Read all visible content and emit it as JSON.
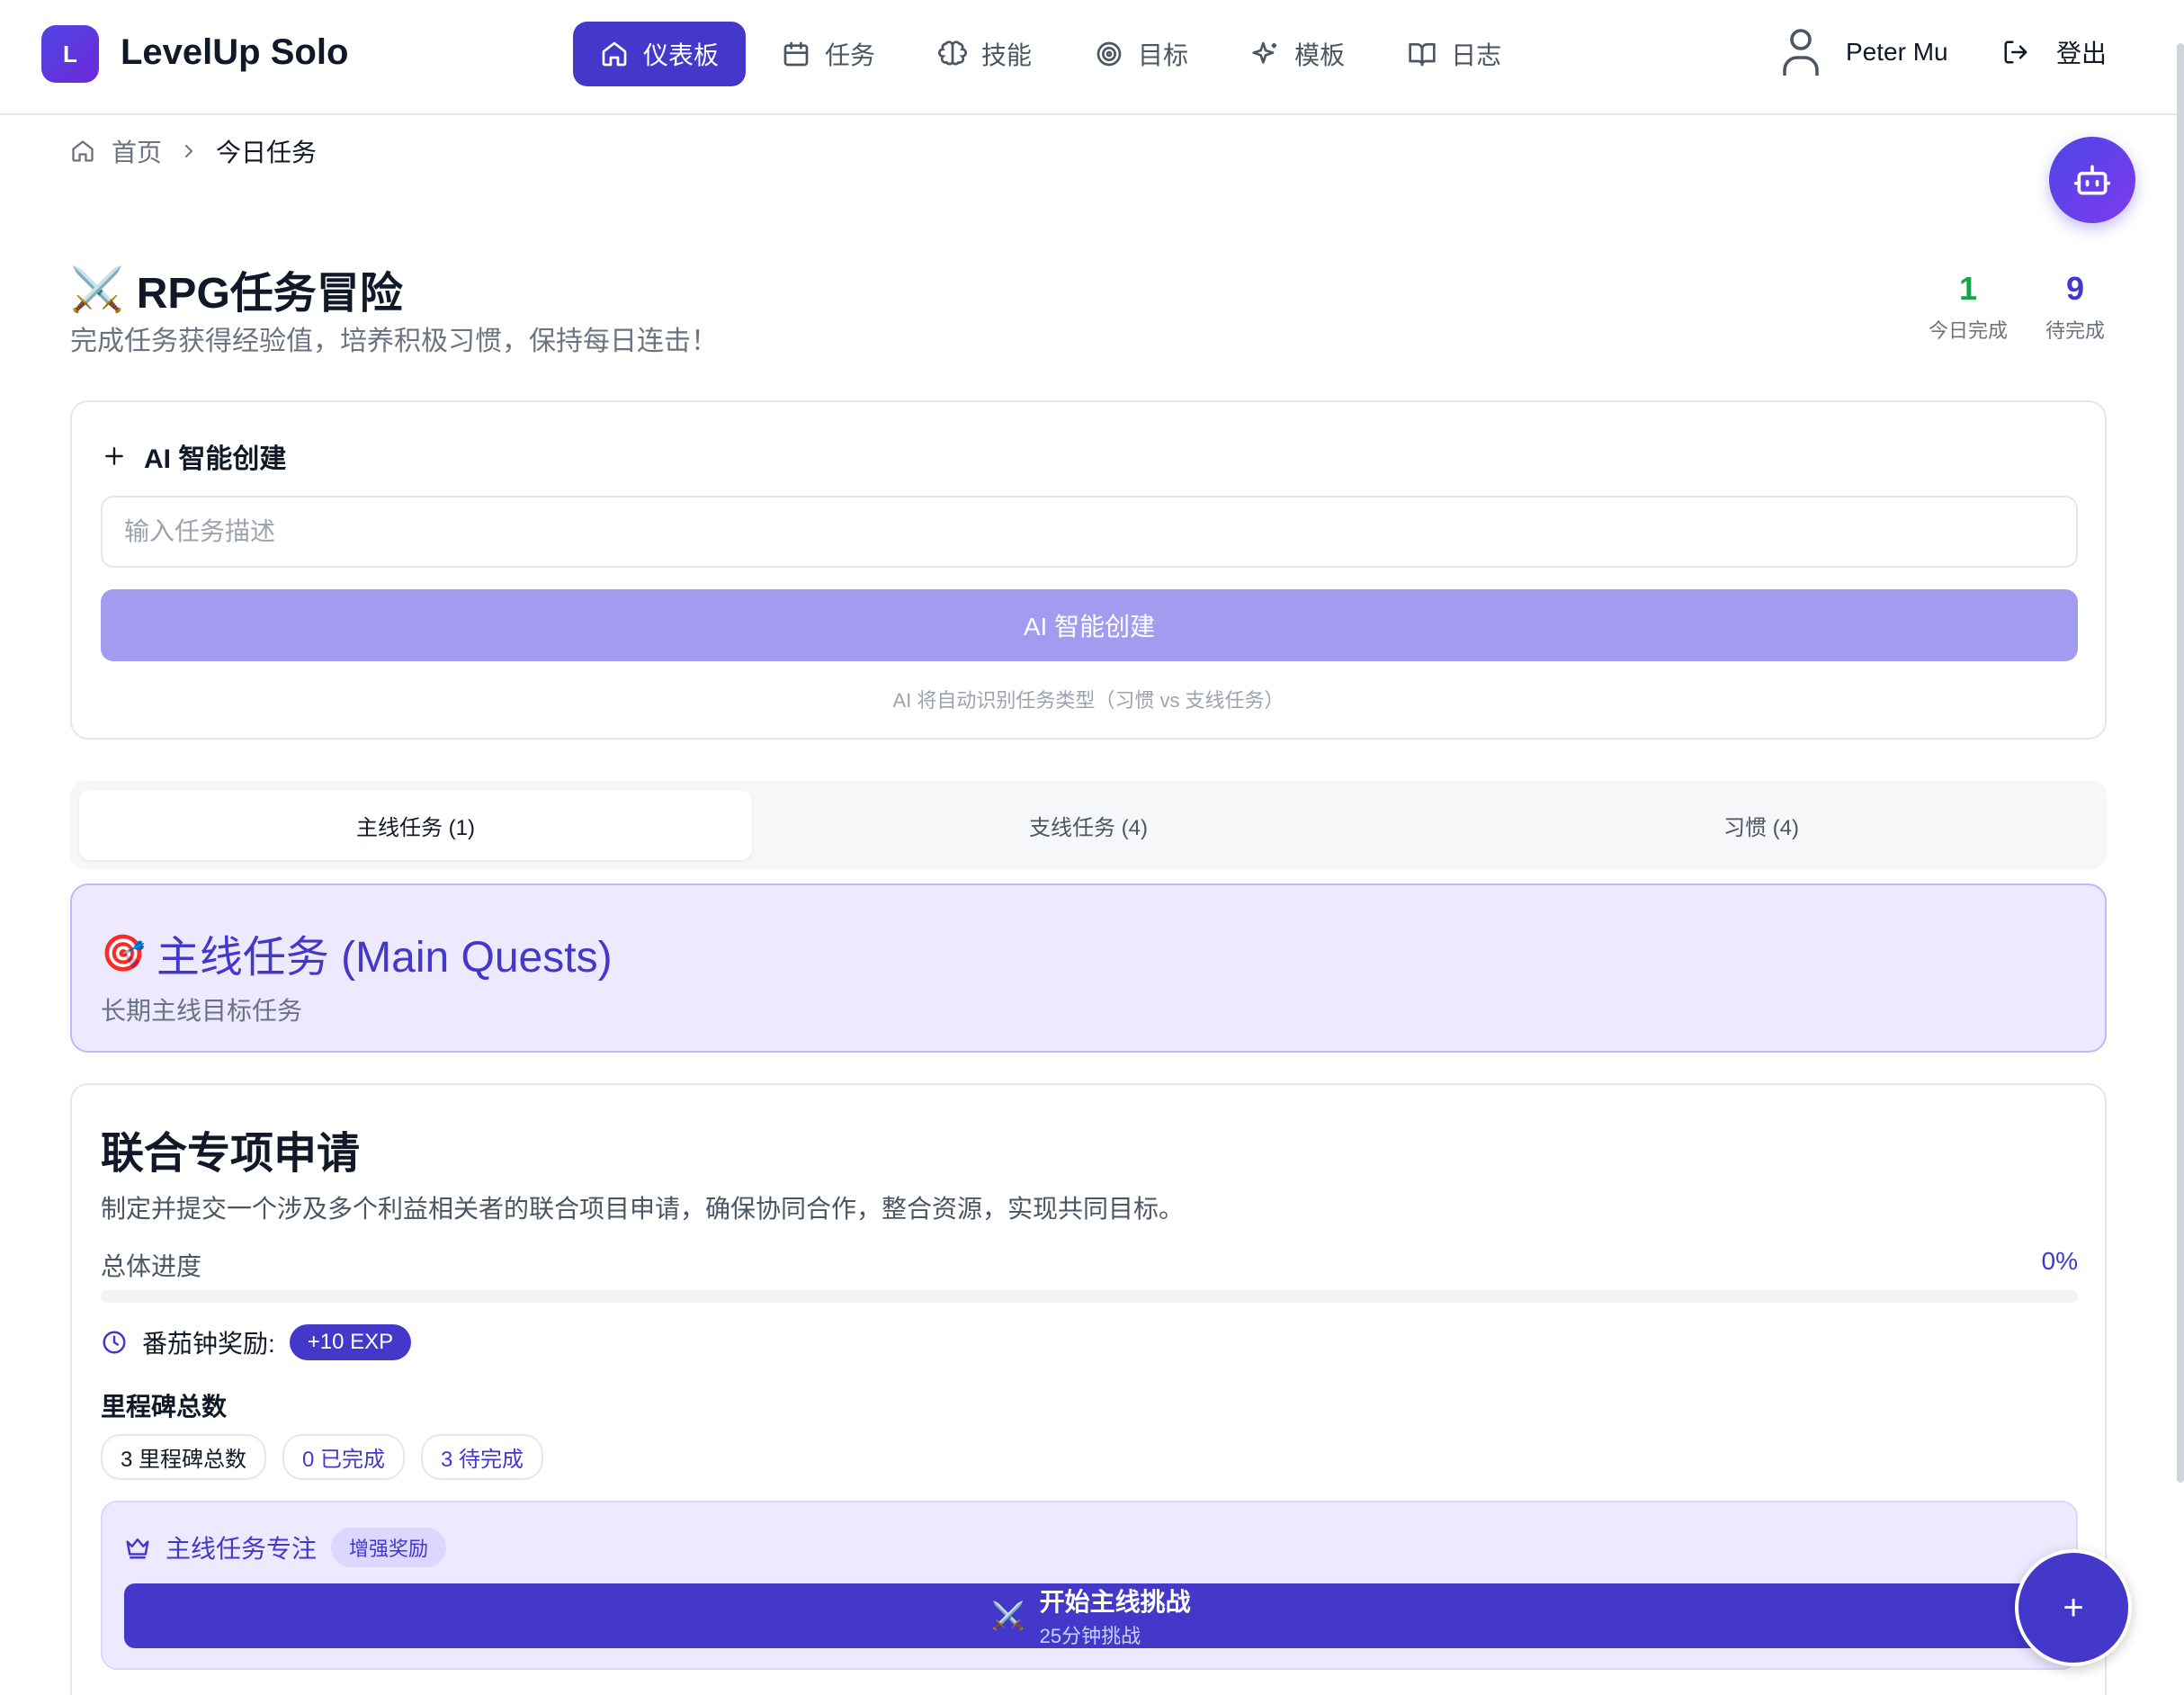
{
  "app": {
    "logo_letter": "L",
    "name": "LevelUp Solo"
  },
  "nav": {
    "items": [
      {
        "label": "仪表板",
        "icon": "home-icon",
        "active": true
      },
      {
        "label": "任务",
        "icon": "calendar-icon"
      },
      {
        "label": "技能",
        "icon": "brain-icon"
      },
      {
        "label": "目标",
        "icon": "target-icon"
      },
      {
        "label": "模板",
        "icon": "sparkles-icon"
      },
      {
        "label": "日志",
        "icon": "book-icon"
      }
    ],
    "user_name": "Peter Mu",
    "logout_label": "登出"
  },
  "breadcrumb": {
    "home": "首页",
    "current": "今日任务"
  },
  "header": {
    "title_emoji": "⚔️",
    "title": "RPG任务冒险",
    "subtitle": "完成任务获得经验值，培养积极习惯，保持每日连击！",
    "stats": [
      {
        "value": "1",
        "label": "今日完成",
        "color": "#16a34a"
      },
      {
        "value": "9",
        "label": "待完成",
        "color": "#4338ca"
      }
    ]
  },
  "ai_create": {
    "title": "AI 智能创建",
    "placeholder": "输入任务描述",
    "button": "AI 智能创建",
    "hint": "AI 将自动识别任务类型（习惯 vs 支线任务）"
  },
  "tabs": [
    {
      "label": "主线任务 (1)",
      "active": true
    },
    {
      "label": "支线任务 (4)"
    },
    {
      "label": "习惯 (4)"
    }
  ],
  "main_banner": {
    "emoji": "🎯",
    "title": "主线任务 (Main Quests)",
    "subtitle": "长期主线目标任务"
  },
  "quest": {
    "title": "联合专项申请",
    "description": "制定并提交一个涉及多个利益相关者的联合项目申请，确保协同合作，整合资源，实现共同目标。",
    "progress_label": "总体进度",
    "progress_value": "0%",
    "progress_fraction": 0,
    "pomodoro_label": "番茄钟奖励:",
    "pomodoro_exp": "+10 EXP",
    "milestones_title": "里程碑总数",
    "milestones": {
      "total": "3 里程碑总数",
      "done": "0 已完成",
      "pending": "3 待完成"
    },
    "focus": {
      "title": "主线任务专注",
      "badge": "增强奖励",
      "button_label": "开始主线挑战",
      "button_sub": "25分钟挑战"
    }
  },
  "fab_label": "+",
  "colors": {
    "primary": "#4338ca",
    "accent_light": "#ede9fe",
    "success": "#16a34a"
  }
}
